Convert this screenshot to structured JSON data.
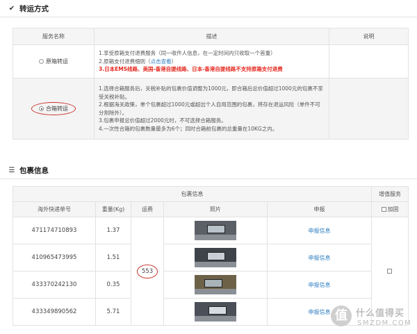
{
  "shipping_section": {
    "icon": "check-icon",
    "title": "转运方式",
    "headers": {
      "name": "服务名称",
      "desc": "描述",
      "note": "说明"
    },
    "options": [
      {
        "name": "原箱转运",
        "selected": false,
        "lines": [
          {
            "text": "1.享受原箱支付退费服务（同一收件人信息，在一定时间内只收取一个首重）"
          },
          {
            "text": "2.原箱支付退费细则（",
            "link": "点击查看",
            "after": "）"
          },
          {
            "text": "3.日本EMS线路、美国-香港自提线路、日本-香港自提线路不支持原箱支付退费",
            "red": true
          }
        ]
      },
      {
        "name": "合箱转运",
        "selected": true,
        "lines": [
          {
            "text": "1.选择合箱服务后，关税补贴的包裹价值调整为1000元，即合箱后总价值超过1000元的包裹不享受关税补贴。"
          },
          {
            "text": "2.根据海关政策，单个包裹超过1000元或超出个人自用范围的包裹，将存在退运风险（单件不可分割除外）。"
          },
          {
            "text": "3.包裹申报总价值超过2000元时，不可选择合箱服务。"
          },
          {
            "text": "4.一次性合箱的包裹数量最多为6个；同时合箱前包裹的总重量在10KG之内。"
          }
        ]
      }
    ]
  },
  "package_section": {
    "icon": "list-icon",
    "title": "包裹信息",
    "group_header": "包裹信息",
    "value_added_header": "增值服务",
    "columns": {
      "tracking": "海外快递单号",
      "weight": "重量(Kg)",
      "fee": "运费",
      "photo": "照片",
      "declare": "申报"
    },
    "reinforce_label": "加固",
    "fee_value": "553",
    "rows": [
      {
        "tracking": "471174710893",
        "weight": "1.37",
        "declare": "申报信息"
      },
      {
        "tracking": "410965473995",
        "weight": "1.51",
        "declare": "申报信息"
      },
      {
        "tracking": "433370242130",
        "weight": "0.35",
        "declare": "申报信息"
      },
      {
        "tracking": "433349890562",
        "weight": "5.71",
        "declare": "申报信息"
      }
    ]
  },
  "watermark": {
    "line1": "什么值得买",
    "line2": "SMZDM.COM",
    "logo": "值"
  },
  "colors": {
    "accent_red": "#c9322b",
    "link_blue": "#2f7fc1",
    "header_bg": "#f5f5f5"
  }
}
